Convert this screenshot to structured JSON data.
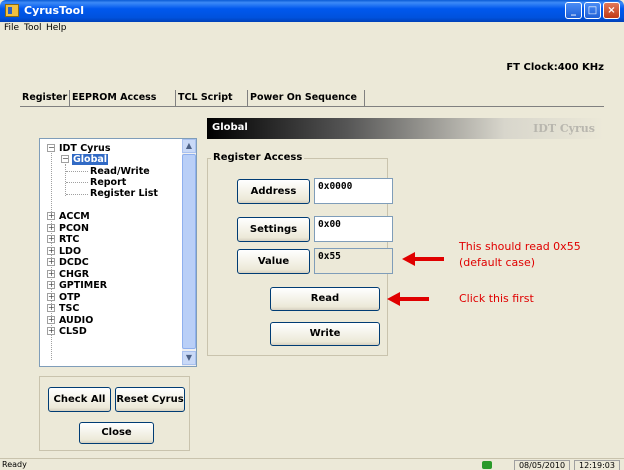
{
  "window": {
    "title": "CyrusTool"
  },
  "menu": [
    "File",
    "Tool",
    "Help"
  ],
  "clock": "FT Clock:400 KHz",
  "tabs": [
    "Register",
    "EEPROM Access",
    "TCL Script",
    "Power On Sequence"
  ],
  "tree": {
    "root": "IDT Cyrus",
    "global": "Global",
    "global_children": [
      "Read/Write",
      "Report",
      "Register List"
    ],
    "nodes": [
      "ACCM",
      "PCON",
      "RTC",
      "LDO",
      "DCDC",
      "CHGR",
      "GPTIMER",
      "OTP",
      "TSC",
      "AUDIO",
      "CLSD"
    ]
  },
  "buttons": {
    "check_all": "Check All",
    "reset": "Reset Cyrus",
    "close": "Close"
  },
  "panel": {
    "title": "Global",
    "brand": "IDT Cyrus"
  },
  "register_access": {
    "legend": "Register Access",
    "address_label": "Address",
    "address_value": "0x0000",
    "settings_label": "Settings",
    "settings_value": "0x00",
    "value_label": "Value",
    "value_value": "0x55",
    "read": "Read",
    "write": "Write"
  },
  "annotations": {
    "value_note_line1": "This should read 0x55",
    "value_note_line2": "(default case)",
    "read_note": "Click this first",
    "color": "#e00000"
  },
  "status": {
    "text": "Ready",
    "date": "08/05/2010",
    "time": "12:19:03"
  }
}
